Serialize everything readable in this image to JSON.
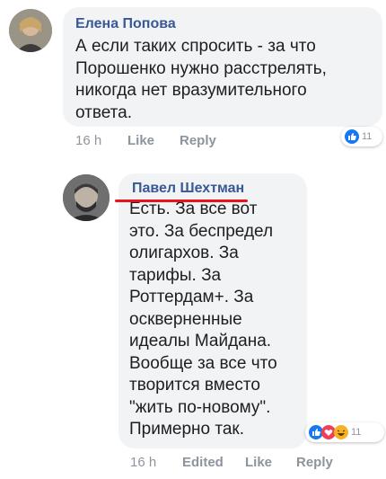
{
  "comments": [
    {
      "author": "Елена Попова",
      "lines": [
        "А если таких спросить - за что",
        "Порошенко нужно расстрелять,",
        "никогда нет вразумительного",
        "ответа."
      ],
      "time": "16 h",
      "like_label": "Like",
      "reply_label": "Reply",
      "reaction_icons": [
        "like-reaction"
      ],
      "reaction_count": "11"
    },
    {
      "author": "Павел Шехтман",
      "lines": [
        "Есть. За все вот",
        "это. За беспредел",
        "олигархов. За",
        "тарифы. За",
        "Роттердам+. За",
        "оскверненные",
        "идеалы Майдана.",
        "Вообще за все что",
        "творится вместо",
        "\"жить по-новому\".",
        "Примерно так."
      ],
      "time": "16 h",
      "edited_label": "Edited",
      "like_label": "Like",
      "reply_label": "Reply",
      "reaction_icons": [
        "like-reaction",
        "love-reaction",
        "haha-reaction"
      ],
      "reaction_count": "11",
      "underline_color": "#e8131d"
    }
  ]
}
